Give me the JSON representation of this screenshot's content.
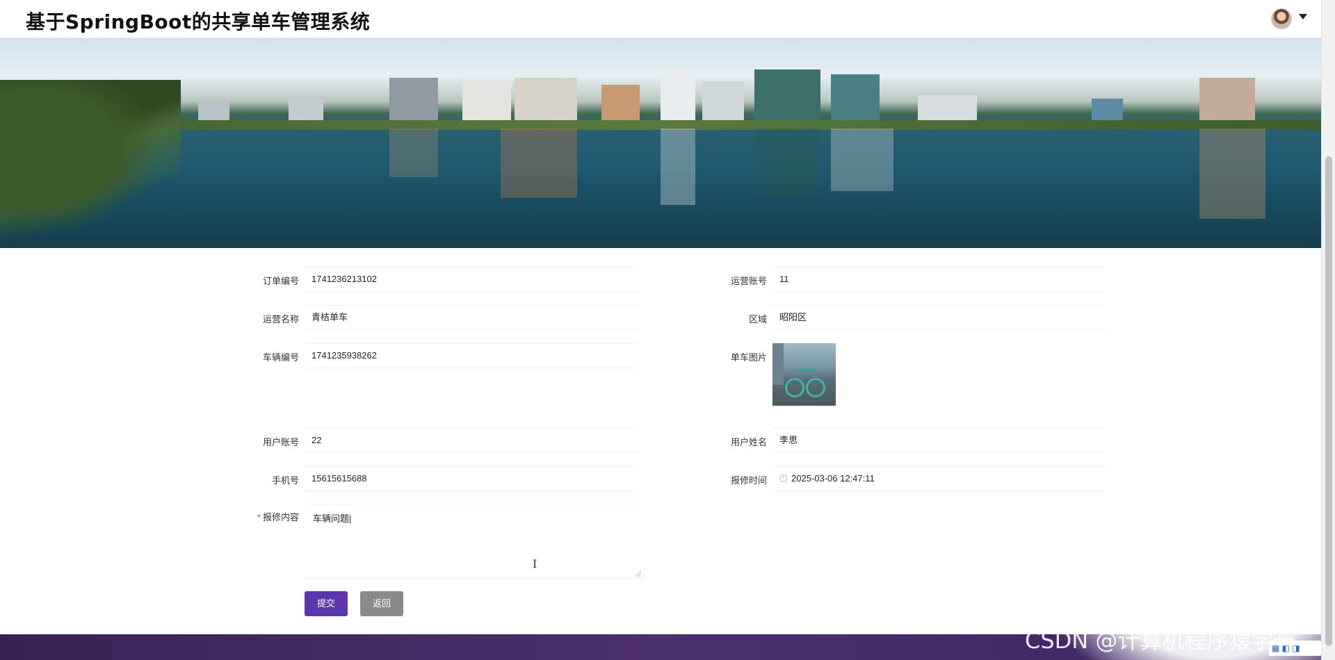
{
  "header": {
    "title": "基于SpringBoot的共享单车管理系统",
    "avatar_icon": "user-avatar-icon",
    "caret_icon": "caret-down-icon"
  },
  "form": {
    "order_no": {
      "label": "订单编号",
      "value": "1741236213102"
    },
    "operator_account": {
      "label": "运营账号",
      "value": "11"
    },
    "operator_name": {
      "label": "运营名称",
      "value": "青桔单车"
    },
    "region": {
      "label": "区域",
      "value": "昭阳区"
    },
    "vehicle_no": {
      "label": "车辆编号",
      "value": "1741235938262"
    },
    "bike_image": {
      "label": "单车图片"
    },
    "user_account": {
      "label": "用户账号",
      "value": "22"
    },
    "user_name": {
      "label": "用户姓名",
      "value": "李思"
    },
    "phone": {
      "label": "手机号",
      "value": "15615615688"
    },
    "repair_time": {
      "label": "报修时间",
      "value": "2025-03-06 12:47:11"
    },
    "repair_content": {
      "label": "报修内容",
      "required_mark": "*",
      "value": "车辆问题|"
    }
  },
  "actions": {
    "submit_label": "提交",
    "back_label": "返回"
  },
  "watermark": "CSDN @计算机程序猿学长",
  "colors": {
    "primary": "#5b36ac",
    "back": "#8a8a8a",
    "footer": "#3c2460"
  }
}
